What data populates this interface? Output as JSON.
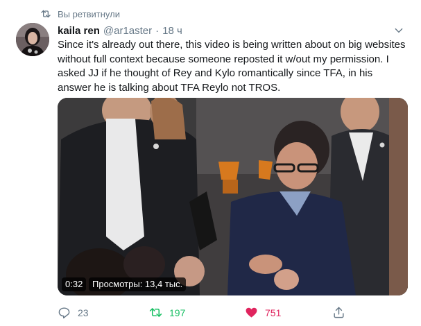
{
  "retweet_notice": "Вы ретвитнули",
  "tweet": {
    "author_name": "kaila ren",
    "handle": "@ar1aster",
    "separator": "·",
    "time": "18 ч",
    "text": "Since it's already out there, this video is being written about on big websites without full context because someone reposted it w/out my permission. I asked JJ if he thought of Rey and Kylo romantically since TFA, in his answer he is talking about TFA Reylo not TROS."
  },
  "video": {
    "duration": "0:32",
    "views": "Просмотры: 13,4 тыс."
  },
  "actions": {
    "reply_count": "23",
    "retweet_count": "197",
    "like_count": "751"
  },
  "colors": {
    "retweet_active": "#17bf63",
    "like_active": "#e0245e",
    "muted": "#657786"
  },
  "icons": [
    "retweet-icon",
    "chevron-down-icon",
    "reply-icon",
    "retweet-icon",
    "heart-icon",
    "share-icon"
  ]
}
